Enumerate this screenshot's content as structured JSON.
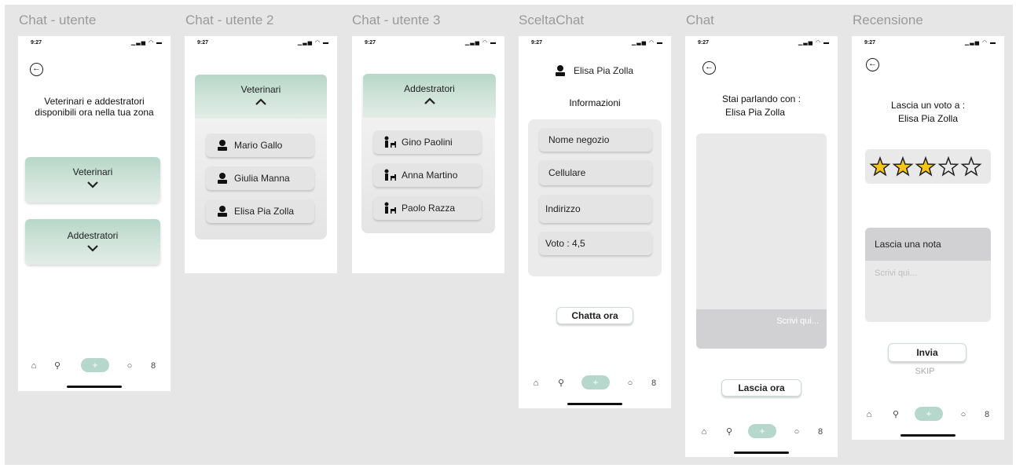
{
  "frames": {
    "f1": {
      "title": "Chat - utente",
      "time": "9:27",
      "heading": "Veterinari e addestratori disponibili ora nella tua zona",
      "card1": "Veterinari",
      "card2": "Addestratori"
    },
    "f2": {
      "title": "Chat - utente 2",
      "time": "9:27",
      "header": "Veterinari",
      "items": [
        "Mario Gallo",
        "Giulia Manna",
        "Elisa Pia Zolla"
      ]
    },
    "f3": {
      "title": "Chat - utente 3",
      "time": "9:27",
      "header": "Addestratori",
      "items": [
        "Gino Paolini",
        "Anna Martino",
        "Paolo Razza"
      ]
    },
    "f4": {
      "title": "SceltaChat",
      "time": "9:27",
      "user": "Elisa Pia Zolla",
      "info_title": "Informazioni",
      "fields": [
        "Nome negozio",
        "Cellulare",
        "Indirizzo",
        "Voto : 4,5"
      ],
      "button": "Chatta ora"
    },
    "f5": {
      "title": "Chat",
      "time": "9:27",
      "talking_label": "Stai parlando con :",
      "user": "Elisa Pia Zolla",
      "placeholder": "Scrivi qui...",
      "button": "Lascia ora"
    },
    "f6": {
      "title": "Recensione",
      "time": "9:27",
      "vote_label": "Lascia un voto a :",
      "user": "Elisa Pia Zolla",
      "rating": 3,
      "rating_max": 5,
      "note_label": "Lascia una nota",
      "note_placeholder": "Scrivi qui...",
      "send": "Invia",
      "skip": "SKIP"
    }
  },
  "tabbar": {
    "plus": "+"
  },
  "colors": {
    "accent_green": "#b7d7c8",
    "star_gold": "#f5c518"
  }
}
